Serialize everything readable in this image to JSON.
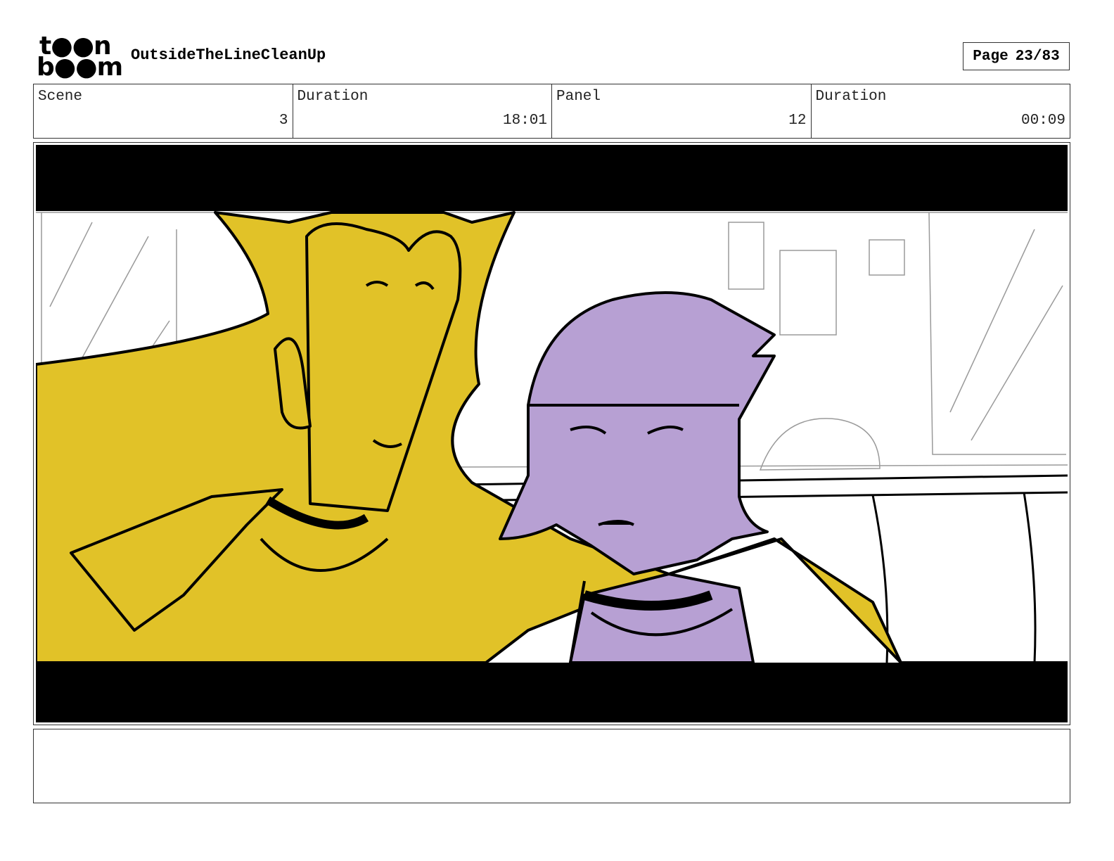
{
  "header": {
    "logo_line1": "t●●n",
    "logo_line2": "b●●m",
    "project_title": "OutsideTheLineCleanUp",
    "page_label": "Page",
    "page_value": "23/83"
  },
  "info": {
    "scene_label": "Scene",
    "scene_value": "3",
    "scene_duration_label": "Duration",
    "scene_duration_value": "18:01",
    "panel_label": "Panel",
    "panel_value": "12",
    "panel_duration_label": "Duration",
    "panel_duration_value": "00:09"
  },
  "panel": {
    "letterbox_color": "#000000",
    "yellow_color": "#E1C228",
    "purple_color": "#B7A0D3",
    "sketch_color": "#9a9a9a"
  },
  "notes": {
    "text": ""
  }
}
